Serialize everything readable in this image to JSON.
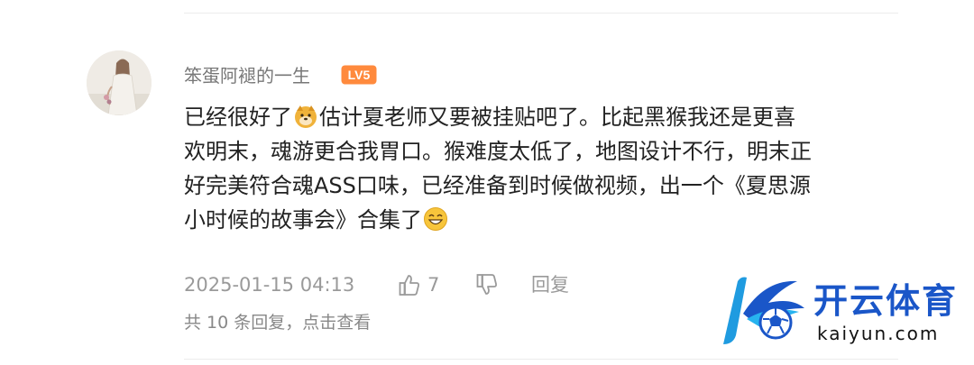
{
  "comment": {
    "username": "笨蛋阿褪的一生",
    "level_badge": "LV5",
    "text_lines": [
      {
        "before": "已经很好了",
        "after": "估计夏老师又要被挂贴吧了。比起黑猴我还是更喜"
      },
      "欢明末，魂游更合我胃口。猴难度太低了，地图设计不行，明末正",
      "好完美符合魂ASS口味，已经准备到时候做视频，出一个《夏思源",
      "小时候的故事会》合集了"
    ],
    "emojis": [
      "doge-emoji",
      "grin-emoji"
    ],
    "timestamp": "2025-01-15 04:13",
    "like_count": "7",
    "reply_label": "回复",
    "replies_summary": "共 10 条回复，点击查看"
  },
  "watermark": {
    "brand_cn": "开云体育",
    "brand_en": "kaiyun.com",
    "color": "#1a56c8"
  }
}
